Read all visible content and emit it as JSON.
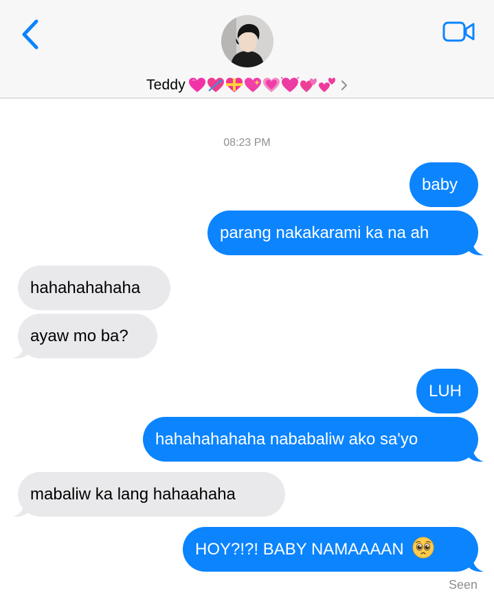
{
  "header": {
    "contact_name": "Teddy",
    "heart_emojis": [
      "growing-heart",
      "heart-with-arrow",
      "heart-with-ribbon",
      "sparkling-heart",
      "growing-heart",
      "beating-heart",
      "revolving-hearts",
      "two-hearts"
    ],
    "accent_color": "#0b84fe"
  },
  "conversation": {
    "timestamp": "08:23 PM",
    "messages": [
      {
        "from": "me",
        "text": "baby"
      },
      {
        "from": "me",
        "text": "parang nakakarami ka na ah"
      },
      {
        "from": "them",
        "text": "hahahahahaha"
      },
      {
        "from": "them",
        "text": "ayaw mo ba?"
      },
      {
        "from": "me",
        "text": "LUH"
      },
      {
        "from": "me",
        "text": "hahahahahaha nababaliw ako sa'yo"
      },
      {
        "from": "them",
        "text": "mabaliw ka lang hahaahaha"
      },
      {
        "from": "me",
        "text": "HOY?!?! BABY NAMAAAAN",
        "emoji": "pleading-face"
      }
    ],
    "status": "Seen"
  },
  "colors": {
    "sent_bubble": "#0b84fe",
    "received_bubble": "#e9e9eb",
    "secondary_text": "#8e8e93"
  }
}
